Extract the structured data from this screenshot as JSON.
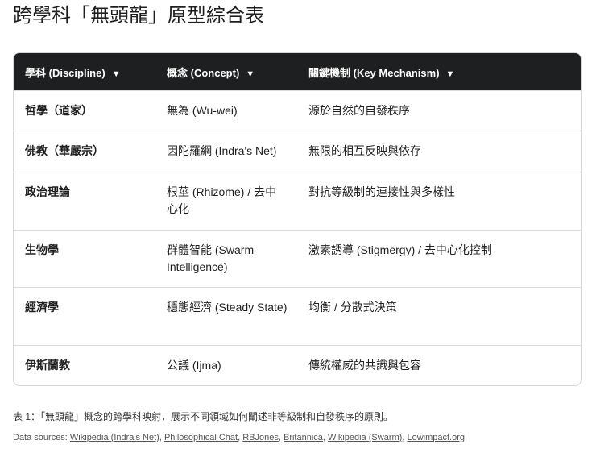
{
  "title": "跨學科「無頭龍」原型綜合表",
  "headers": [
    "學科 (Discipline)",
    "概念 (Concept)",
    "關鍵機制 (Key Mechanism)"
  ],
  "sort_icon": "▼",
  "rows": [
    [
      "哲學（道家）",
      "無為 (Wu-wei)",
      "源於自然的自發秩序"
    ],
    [
      "佛教（華嚴宗）",
      "因陀羅網 (Indra's Net)",
      "無限的相互反映與依存"
    ],
    [
      "政治理論",
      "根莖 (Rhizome) / 去中心化",
      "對抗等級制的連接性與多樣性"
    ],
    [
      "生物學",
      "群體智能 (Swarm Intelligence)",
      "激素誘導 (Stigmergy) / 去中心化控制"
    ],
    [
      "經濟學",
      "穩態經濟 (Steady State)",
      "均衡 / 分散式決策"
    ],
    [
      "伊斯蘭教",
      "公議 (Ijma)",
      "傳統權威的共識與包容"
    ]
  ],
  "caption": "表 1：「無頭龍」概念的跨學科映射，展示不同領域如何闡述非等級制和自發秩序的原則。",
  "sources_label": "Data sources: ",
  "sources": [
    "Wikipedia (Indra's Net)",
    "Philosophical Chat",
    "RBJones",
    "Britannica",
    "Wikipedia (Swarm)",
    "Lowimpact.org"
  ]
}
